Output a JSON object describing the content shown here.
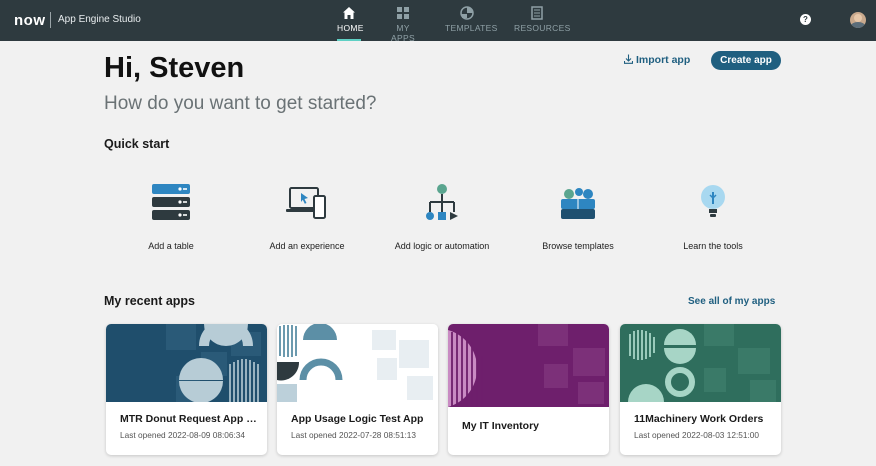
{
  "header": {
    "logo": "now",
    "app_title": "App Engine Studio",
    "nav": [
      {
        "label": "HOME",
        "icon": "home-icon",
        "active": true
      },
      {
        "label": "MY APPS",
        "icon": "grid-icon",
        "active": false
      },
      {
        "label": "TEMPLATES",
        "icon": "templates-icon",
        "active": false
      },
      {
        "label": "RESOURCES",
        "icon": "book-icon",
        "active": false
      }
    ],
    "help_icon": "?"
  },
  "hero": {
    "greeting": "Hi, Steven",
    "subtitle": "How do you want to get started?",
    "import_label": "Import app",
    "create_label": "Create app"
  },
  "quick_start": {
    "title": "Quick start",
    "items": [
      {
        "label": "Add a table",
        "icon": "database-icon"
      },
      {
        "label": "Add an experience",
        "icon": "devices-icon"
      },
      {
        "label": "Add logic or automation",
        "icon": "flow-icon"
      },
      {
        "label": "Browse templates",
        "icon": "templates-people-icon"
      },
      {
        "label": "Learn the tools",
        "icon": "lightbulb-icon"
      }
    ]
  },
  "recent_apps": {
    "title": "My recent apps",
    "see_all_label": "See all of my apps",
    "apps": [
      {
        "name": "MTR Donut Request App T...",
        "last_opened": "Last opened 2022-08-09 08:06:34",
        "color": "#1f5070"
      },
      {
        "name": "App Usage Logic Test App",
        "last_opened": "Last opened 2022-07-28 08:51:13",
        "color": "#ffffff"
      },
      {
        "name": "My IT Inventory",
        "last_opened": "",
        "color": "#6e1f6c"
      },
      {
        "name": "11Machinery Work Orders",
        "last_opened": "Last opened 2022-08-03 12:51:00",
        "color": "#2f6e5d"
      }
    ]
  },
  "colors": {
    "topbar": "#2e3a3f",
    "accent": "#1f5f80",
    "active_tab": "#5fd0c4"
  }
}
